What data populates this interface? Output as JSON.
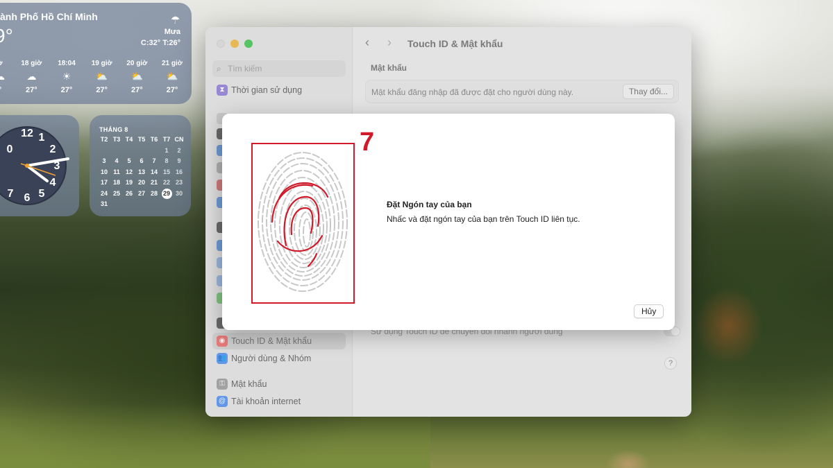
{
  "weather": {
    "city": "ành Phố Hồ Chí Minh",
    "temp": "9°",
    "condition_icon": "cloud-rain-icon",
    "condition": "Mưa",
    "hilo": "C:32° T:26°",
    "hours": [
      {
        "time": "ờ",
        "icon": "cloud-rain-icon",
        "temp": "°"
      },
      {
        "time": "18 giờ",
        "icon": "cloud-rain-icon",
        "temp": "27°"
      },
      {
        "time": "18:04",
        "icon": "sunset-icon",
        "temp": "27°"
      },
      {
        "time": "19 giờ",
        "icon": "cloud-sun-rain-icon",
        "temp": "27°"
      },
      {
        "time": "20 giờ",
        "icon": "cloud-sun-rain-icon",
        "temp": "27°"
      },
      {
        "time": "21 giờ",
        "icon": "cloud-sun-rain-icon",
        "temp": "27°"
      }
    ]
  },
  "clock": {
    "numbers": [
      "12",
      "1",
      "2",
      "3",
      "4",
      "5",
      "6",
      "7",
      "0"
    ]
  },
  "calendar": {
    "month": "THÁNG 8",
    "weekdays": [
      "T2",
      "T3",
      "T4",
      "T5",
      "T6",
      "T7",
      "CN"
    ],
    "weeks": [
      [
        "",
        "",
        "",
        "",
        "",
        "1",
        "2"
      ],
      [
        "3",
        "4",
        "5",
        "6",
        "7",
        "8",
        "9"
      ],
      [
        "10",
        "11",
        "12",
        "13",
        "14",
        "15",
        "16"
      ],
      [
        "17",
        "18",
        "19",
        "20",
        "21",
        "22",
        "23"
      ],
      [
        "24",
        "25",
        "26",
        "27",
        "28",
        "29",
        "30"
      ],
      [
        "31",
        "",
        "",
        "",
        "",
        "",
        ""
      ]
    ],
    "today": "29"
  },
  "settings": {
    "search_placeholder": "Tìm kiếm",
    "sidebar_items": [
      {
        "label": "Thời gian sử dụng",
        "icon": "hourglass-icon",
        "color": "#8e7bd6"
      },
      {
        "label": "Touch ID & Mật khẩu",
        "icon": "fingerprint-icon",
        "color": "#ef6a6a"
      },
      {
        "label": "Người dùng & Nhóm",
        "icon": "users-icon",
        "color": "#4d8ef0"
      },
      {
        "label": "Mật khẩu",
        "icon": "key-icon",
        "color": "#9a9a9a"
      },
      {
        "label": "Tài khoản internet",
        "icon": "at-icon",
        "color": "#4d8ef0"
      }
    ],
    "title": "Touch ID & Mật khẩu",
    "section": "Mật khẩu",
    "password_text": "Mật khẩu đăng nhập đã được đặt cho người dùng này.",
    "change_button": "Thay đổi...",
    "fast_switch": "Sử dụng Touch ID để chuyển đổi nhanh người dùng",
    "help": "?"
  },
  "sheet": {
    "step": "7",
    "title": "Đặt Ngón tay của bạn",
    "description": "Nhấc và đặt ngón tay của bạn trên Touch ID liên tục.",
    "cancel": "Hủy"
  },
  "colors": {
    "highlight": "#d01a2a"
  }
}
